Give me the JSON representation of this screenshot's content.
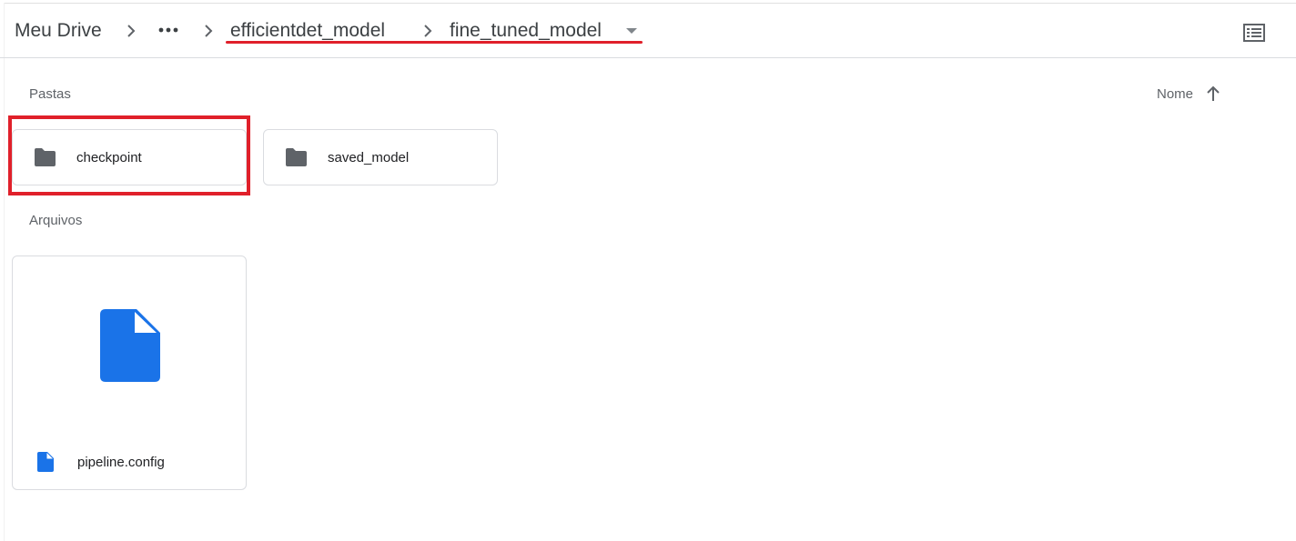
{
  "breadcrumb": {
    "root": "Meu Drive",
    "overflow_icon": "more-horiz-icon",
    "items": [
      "efficientdet_model",
      "fine_tuned_model"
    ],
    "separator_icon": "chevron-right-icon",
    "dropdown_icon": "caret-down-icon"
  },
  "toolbar": {
    "view_toggle_icon": "list-view-icon"
  },
  "sections": {
    "folders_label": "Pastas",
    "files_label": "Arquivos"
  },
  "sort": {
    "label": "Nome",
    "direction_icon": "arrow-up-icon"
  },
  "folders": [
    {
      "name": "checkpoint",
      "icon": "folder-icon",
      "highlighted": true
    },
    {
      "name": "saved_model",
      "icon": "folder-icon",
      "highlighted": false
    }
  ],
  "files": [
    {
      "name": "pipeline.config",
      "icon": "file-icon"
    }
  ],
  "colors": {
    "highlight": "#e0202a",
    "folder_icon": "#5f6368",
    "file_icon": "#1a73e8",
    "border": "#dadce0",
    "text_secondary": "#5f6368"
  }
}
